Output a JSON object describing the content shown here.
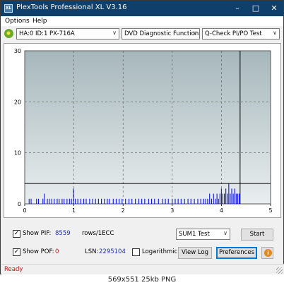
{
  "window": {
    "title": "PlexTools Professional XL V3.16",
    "icon_label": "XL"
  },
  "menu": {
    "options": "Options",
    "help": "Help"
  },
  "toolbar": {
    "drive": "HA:0 ID:1  PX-716A",
    "function": "DVD Diagnostic Functions",
    "test": "Q-Check PI/PO Test"
  },
  "chart_data": {
    "type": "bar",
    "title": "",
    "xlabel": "",
    "ylabel": "",
    "xlim": [
      0,
      5
    ],
    "ylim": [
      0,
      30
    ],
    "x_ticks": [
      "0",
      "1",
      "2",
      "3",
      "4",
      "5"
    ],
    "y_ticks": [
      "0",
      "10",
      "20",
      "30"
    ],
    "threshold": 4,
    "end_marker_x": 4.38,
    "grid": true,
    "colors": {
      "bars": "#0a14e6",
      "background_top": "#a6b7bb",
      "background_bottom": "#e9eeef",
      "line": "#000000"
    },
    "series": [
      {
        "values": [
          [
            0.09,
            1
          ],
          [
            0.13,
            1
          ],
          [
            0.24,
            1
          ],
          [
            0.28,
            1
          ],
          [
            0.37,
            1
          ],
          [
            0.4,
            2
          ],
          [
            0.46,
            1
          ],
          [
            0.5,
            1
          ],
          [
            0.55,
            1
          ],
          [
            0.6,
            1
          ],
          [
            0.66,
            1
          ],
          [
            0.7,
            1
          ],
          [
            0.76,
            1
          ],
          [
            0.8,
            1
          ],
          [
            0.86,
            1
          ],
          [
            0.91,
            1
          ],
          [
            0.95,
            1
          ],
          [
            0.99,
            3
          ],
          [
            1.03,
            1
          ],
          [
            1.08,
            1
          ],
          [
            1.14,
            1
          ],
          [
            1.2,
            1
          ],
          [
            1.25,
            1
          ],
          [
            1.32,
            1
          ],
          [
            1.38,
            1
          ],
          [
            1.44,
            1
          ],
          [
            1.5,
            1
          ],
          [
            1.56,
            1
          ],
          [
            1.62,
            1
          ],
          [
            1.68,
            1
          ],
          [
            1.72,
            1
          ],
          [
            1.8,
            1
          ],
          [
            1.86,
            1
          ],
          [
            1.92,
            1
          ],
          [
            1.98,
            1
          ],
          [
            2.05,
            1
          ],
          [
            2.12,
            1
          ],
          [
            2.18,
            1
          ],
          [
            2.25,
            1
          ],
          [
            2.32,
            1
          ],
          [
            2.38,
            1
          ],
          [
            2.44,
            1
          ],
          [
            2.52,
            1
          ],
          [
            2.58,
            1
          ],
          [
            2.64,
            1
          ],
          [
            2.72,
            1
          ],
          [
            2.8,
            1
          ],
          [
            2.86,
            1
          ],
          [
            2.92,
            1
          ],
          [
            3.0,
            1
          ],
          [
            3.06,
            1
          ],
          [
            3.12,
            1
          ],
          [
            3.18,
            1
          ],
          [
            3.25,
            1
          ],
          [
            3.32,
            1
          ],
          [
            3.38,
            1
          ],
          [
            3.45,
            1
          ],
          [
            3.52,
            1
          ],
          [
            3.58,
            1
          ],
          [
            3.64,
            1
          ],
          [
            3.68,
            1
          ],
          [
            3.72,
            1
          ],
          [
            3.76,
            2
          ],
          [
            3.8,
            1
          ],
          [
            3.84,
            2
          ],
          [
            3.88,
            1
          ],
          [
            3.91,
            2
          ],
          [
            3.94,
            1
          ],
          [
            3.97,
            2
          ],
          [
            4.0,
            3
          ],
          [
            4.03,
            2
          ],
          [
            4.06,
            2
          ],
          [
            4.09,
            3
          ],
          [
            4.12,
            2
          ],
          [
            4.15,
            4
          ],
          [
            4.18,
            2
          ],
          [
            4.21,
            3
          ],
          [
            4.24,
            2
          ],
          [
            4.27,
            3
          ],
          [
            4.3,
            2
          ],
          [
            4.33,
            2
          ],
          [
            4.36,
            2
          ]
        ]
      }
    ]
  },
  "controls": {
    "show_pif_label": "Show PIF:",
    "pif_value": "8559",
    "pif_unit": "rows/1ECC",
    "show_pof_label": "Show POF:",
    "pof_value": "0",
    "lsn_label": "LSN:",
    "lsn_value": "2295104",
    "logarithmic_label": "Logarithmic",
    "sum_select": "SUM1 Test",
    "start_label": "Start",
    "view_log_label": "View Log",
    "preferences_label": "Preferences",
    "pif_checked": true,
    "pof_checked": true,
    "log_checked": false
  },
  "status": {
    "text": "Ready"
  },
  "caption": "569x551  25kb  PNG"
}
